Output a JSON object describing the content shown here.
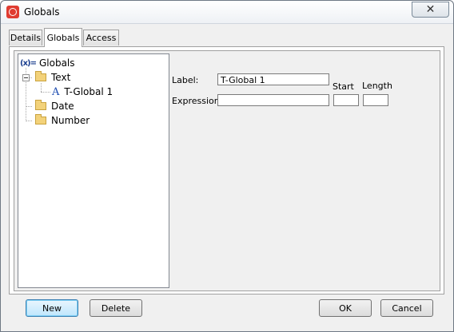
{
  "window": {
    "title": "Globals",
    "close_symbol": "✕"
  },
  "tabs": [
    {
      "label": "Details",
      "active": false
    },
    {
      "label": "Globals",
      "active": true
    },
    {
      "label": "Access",
      "active": false
    }
  ],
  "tree": {
    "root": {
      "label": "Globals",
      "icon_text": "(x)=",
      "icon": "variables-icon"
    },
    "children": [
      {
        "label": "Text",
        "icon": "folder-open-icon",
        "children": [
          {
            "label": "T-Global 1",
            "icon": "text-variable-icon"
          }
        ]
      },
      {
        "label": "Date",
        "icon": "folder-icon"
      },
      {
        "label": "Number",
        "icon": "folder-icon"
      }
    ]
  },
  "form": {
    "label_caption": "Label:",
    "label_value": "T-Global 1",
    "expression_caption": "Expression:",
    "expression_value": "",
    "start_caption": "Start",
    "start_value": "",
    "length_caption": "Length",
    "length_value": ""
  },
  "buttons": {
    "new": "New",
    "delete": "Delete",
    "ok": "OK",
    "cancel": "Cancel"
  },
  "colors": {
    "default_button_border": "#3c7fb1",
    "app_icon": "#e03c31"
  }
}
